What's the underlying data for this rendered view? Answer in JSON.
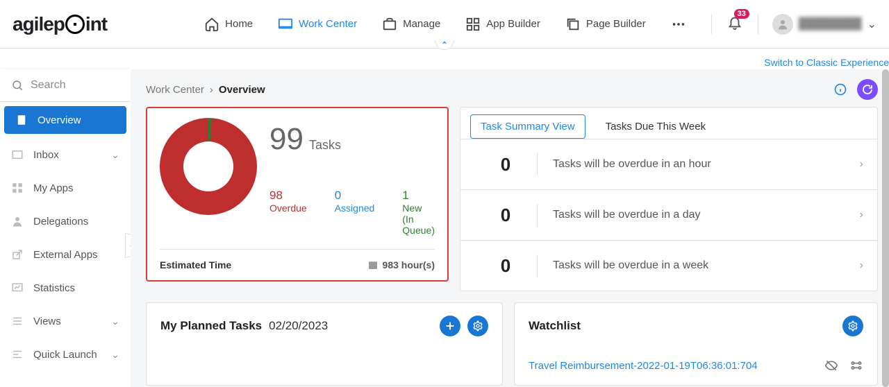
{
  "header": {
    "logo_text_a": "agilep",
    "logo_text_b": "int",
    "nav": [
      {
        "label": "Home",
        "id": "home"
      },
      {
        "label": "Work Center",
        "id": "work-center"
      },
      {
        "label": "Manage",
        "id": "manage"
      },
      {
        "label": "App Builder",
        "id": "app-builder"
      },
      {
        "label": "Page Builder",
        "id": "page-builder"
      }
    ],
    "notification_count": "33",
    "user_name": "████████",
    "classic_link": "Switch to Classic Experience"
  },
  "sidebar": {
    "search_placeholder": "Search",
    "items": [
      {
        "label": "Overview",
        "chevron": false
      },
      {
        "label": "Inbox",
        "chevron": true
      },
      {
        "label": "My Apps",
        "chevron": false
      },
      {
        "label": "Delegations",
        "chevron": false
      },
      {
        "label": "External Apps",
        "chevron": false
      },
      {
        "label": "Statistics",
        "chevron": false
      },
      {
        "label": "Views",
        "chevron": true
      },
      {
        "label": "Quick Launch",
        "chevron": true
      }
    ]
  },
  "breadcrumb": {
    "parent": "Work Center",
    "sep": "›",
    "current": "Overview"
  },
  "summary": {
    "total": "99",
    "total_label": "Tasks",
    "overdue": {
      "count": "98",
      "label": "Overdue"
    },
    "assigned": {
      "count": "0",
      "label": "Assigned"
    },
    "newq": {
      "count": "1",
      "label": "New",
      "sub": "(In Queue)"
    },
    "est_label": "Estimated Time",
    "est_value": "983 hour(s)"
  },
  "due": {
    "tabs": [
      {
        "label": "Task Summary View"
      },
      {
        "label": "Tasks Due This Week"
      }
    ],
    "rows": [
      {
        "count": "0",
        "text": "Tasks will be overdue in an hour"
      },
      {
        "count": "0",
        "text": "Tasks will be overdue in a day"
      },
      {
        "count": "0",
        "text": "Tasks will be overdue in a week"
      }
    ]
  },
  "planned": {
    "title": "My Planned Tasks",
    "date": "02/20/2023"
  },
  "watchlist": {
    "title": "Watchlist",
    "item": "Travel Reimbursement-2022-01-19T06:36:01:704"
  },
  "chart_data": {
    "type": "pie",
    "title": "Tasks",
    "series": [
      {
        "name": "Overdue",
        "value": 98,
        "color": "#be2e2e"
      },
      {
        "name": "Assigned",
        "value": 0,
        "color": "#1e88e5"
      },
      {
        "name": "New (In Queue)",
        "value": 1,
        "color": "#2e7d32"
      }
    ],
    "total": 99
  }
}
